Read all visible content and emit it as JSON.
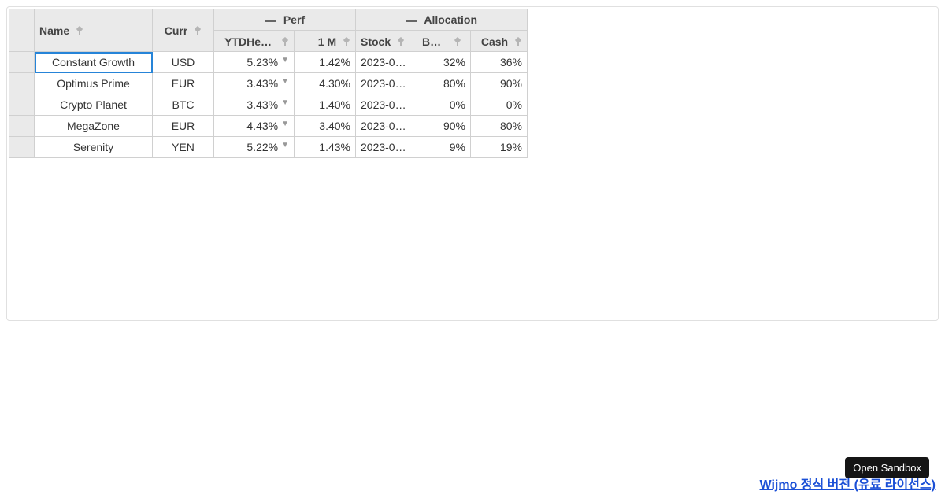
{
  "header": {
    "name": "Name",
    "curr": "Curr",
    "perf_group": "Perf",
    "alloc_group": "Allocation",
    "ytd": "YTDHeaderYTDHeaderYTDHeader",
    "m1": "1 M",
    "stock": "Stock",
    "bond": "Bond",
    "cash": "Cash"
  },
  "rows": [
    {
      "name": "Constant Growth",
      "curr": "USD",
      "ytd": "5.23%",
      "m1": "1.42%",
      "stock": "2023-0…",
      "bond": "32%",
      "cash": "36%"
    },
    {
      "name": "Optimus Prime",
      "curr": "EUR",
      "ytd": "3.43%",
      "m1": "4.30%",
      "stock": "2023-0…",
      "bond": "80%",
      "cash": "90%"
    },
    {
      "name": "Crypto Planet",
      "curr": "BTC",
      "ytd": "3.43%",
      "m1": "1.40%",
      "stock": "2023-0…",
      "bond": "0%",
      "cash": "0%"
    },
    {
      "name": "MegaZone",
      "curr": "EUR",
      "ytd": "4.43%",
      "m1": "3.40%",
      "stock": "2023-0…",
      "bond": "90%",
      "cash": "80%"
    },
    {
      "name": "Serenity",
      "curr": "YEN",
      "ytd": "5.22%",
      "m1": "1.43%",
      "stock": "2023-0…",
      "bond": "9%",
      "cash": "19%"
    }
  ],
  "footer": {
    "link_text": "Wijmo 정식 버전 (유료 라이선스)",
    "sandbox": "Open Sandbox"
  }
}
